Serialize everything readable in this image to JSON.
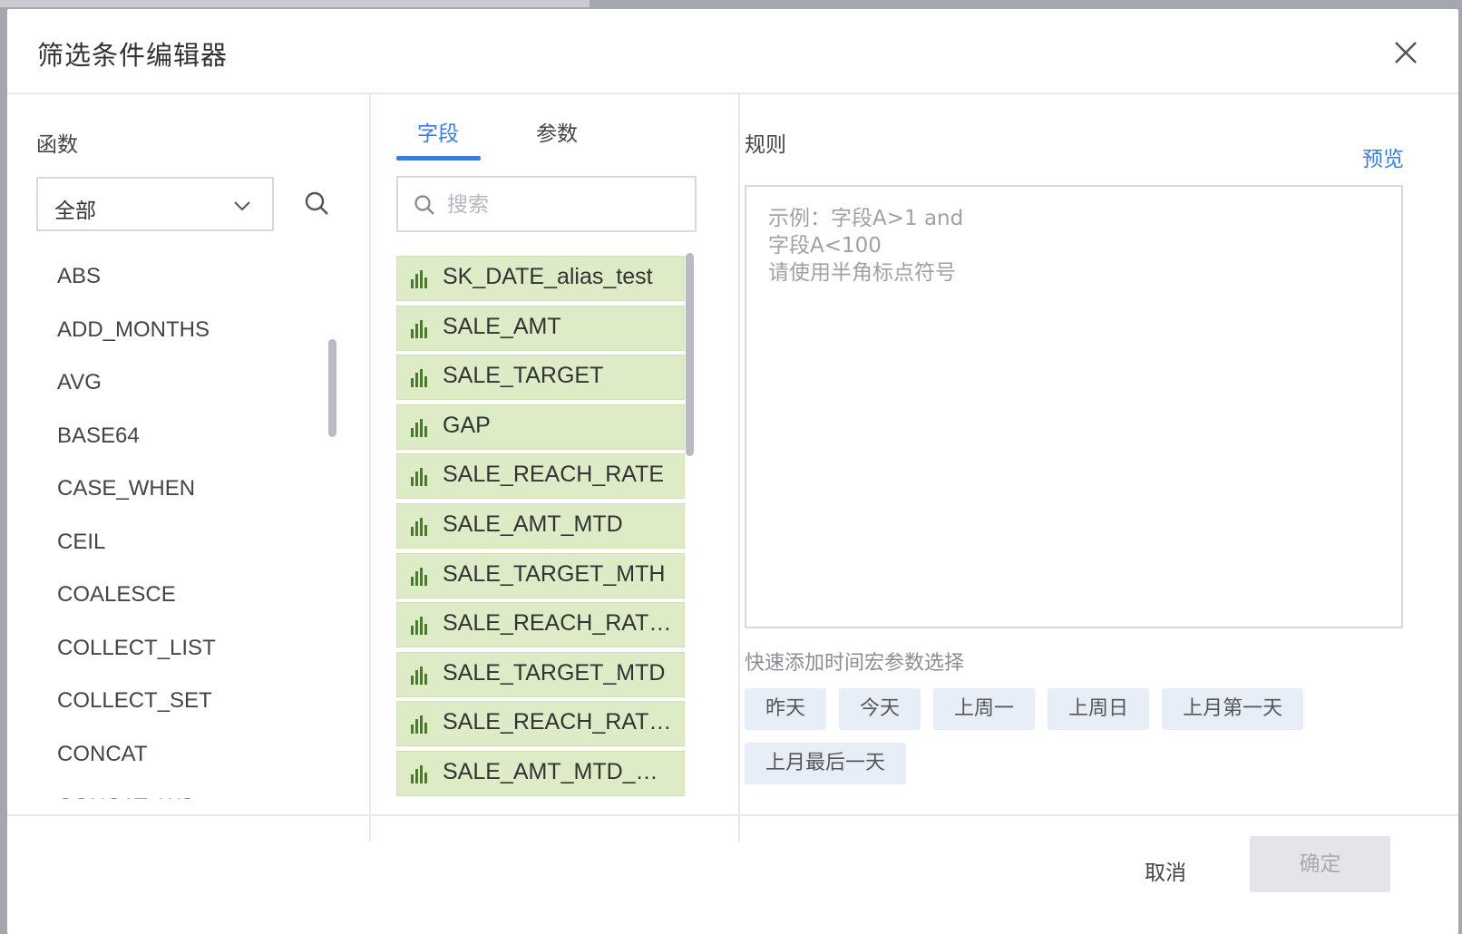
{
  "dialog": {
    "title": "筛选条件编辑器"
  },
  "functions": {
    "label": "函数",
    "category_selected": "全部",
    "items": [
      "ABS",
      "ADD_MONTHS",
      "AVG",
      "BASE64",
      "CASE_WHEN",
      "CEIL",
      "COALESCE",
      "COLLECT_LIST",
      "COLLECT_SET",
      "CONCAT",
      "CONCAT_WS"
    ]
  },
  "fields": {
    "tabs": [
      "字段",
      "参数"
    ],
    "active_tab": "字段",
    "search_placeholder": "搜索",
    "items": [
      "SK_DATE_alias_test",
      "SALE_AMT",
      "SALE_TARGET",
      "GAP",
      "SALE_REACH_RATE",
      "SALE_AMT_MTD",
      "SALE_TARGET_MTH",
      "SALE_REACH_RAT…",
      "SALE_TARGET_MTD",
      "SALE_REACH_RAT…",
      "SALE_AMT_MTD_…"
    ]
  },
  "rule": {
    "label": "规则",
    "preview_label": "预览",
    "placeholder": "示例：字段A>1 and\n字段A<100\n请使用半角标点符号",
    "macro_label": "快速添加时间宏参数选择",
    "macros": [
      "昨天",
      "今天",
      "上周一",
      "上周日",
      "上月第一天",
      "上月最后一天"
    ]
  },
  "footer": {
    "cancel_label": "取消",
    "ok_label": "确定"
  },
  "colors": {
    "accent": "#3b7ce2",
    "field_bg": "#ddebc6",
    "field_icon": "#4a7a2c",
    "macro_bg": "#e8eef8"
  },
  "icons": {
    "close": "close-icon",
    "chevron": "chevron-down-icon",
    "search": "search-icon",
    "measure": "bar-chart-icon"
  }
}
